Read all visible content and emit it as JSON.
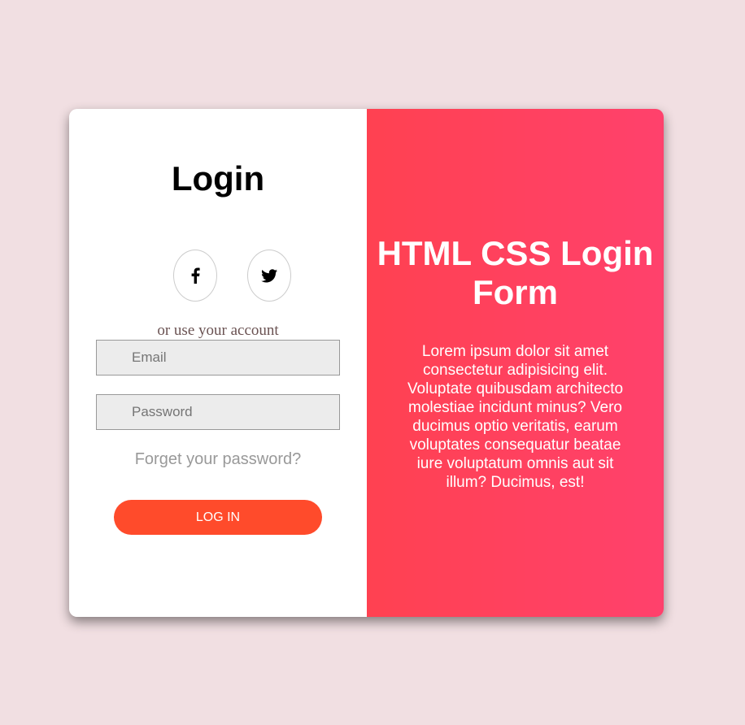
{
  "login": {
    "title": "Login",
    "social": [
      {
        "name": "facebook-icon"
      },
      {
        "name": "twitter-icon"
      }
    ],
    "or_text": "or use your account",
    "email_placeholder": "Email",
    "password_placeholder": "Password",
    "forgot_text": "Forget your password?",
    "login_button": "LOG IN"
  },
  "overlay": {
    "title": "HTML CSS Login Form",
    "text": "Lorem ipsum dolor sit amet consectetur adipisicing elit. Voluptate quibusdam architecto molestiae incidunt minus? Vero ducimus optio veritatis, earum voluptates consequatur beatae iure voluptatum omnis aut sit illum? Ducimus, est!"
  },
  "colors": {
    "page_background": "#f1dfe2",
    "gradient_start": "#ff4151",
    "gradient_end": "#ff416c",
    "button": "#ff4b2b"
  }
}
